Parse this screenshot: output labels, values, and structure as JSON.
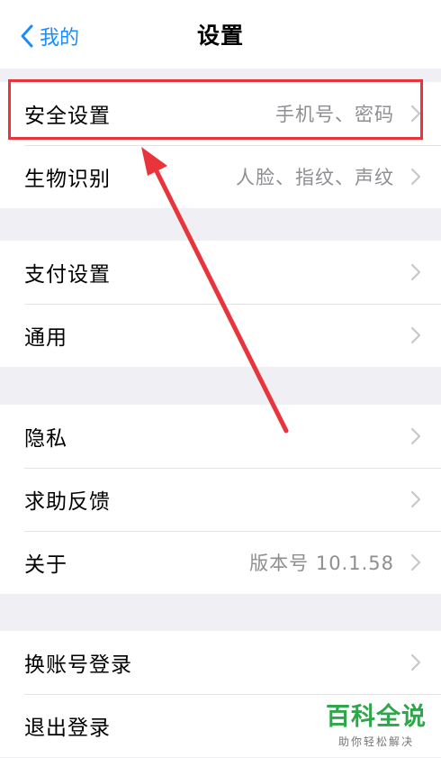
{
  "nav": {
    "back_label": "我的",
    "title": "设置"
  },
  "groups": [
    {
      "rows": [
        {
          "label": "安全设置",
          "value": "手机号、密码"
        },
        {
          "label": "生物识别",
          "value": "人脸、指纹、声纹"
        }
      ]
    },
    {
      "rows": [
        {
          "label": "支付设置",
          "value": ""
        },
        {
          "label": "通用",
          "value": ""
        }
      ]
    },
    {
      "rows": [
        {
          "label": "隐私",
          "value": ""
        },
        {
          "label": "求助反馈",
          "value": ""
        },
        {
          "label": "关于",
          "value": "版本号 10.1.58"
        }
      ]
    },
    {
      "rows": [
        {
          "label": "换账号登录",
          "value": ""
        },
        {
          "label": "退出登录",
          "value": ""
        }
      ]
    }
  ],
  "watermark": {
    "title": "百科全说",
    "subtitle": "助你轻松解决"
  },
  "colors": {
    "accent": "#1a8cff",
    "annotation": "#e8343a",
    "watermark": "#2ea64a",
    "background": "#efeff4"
  },
  "icons": [
    "chevron-left-icon",
    "chevron-right-icon"
  ]
}
